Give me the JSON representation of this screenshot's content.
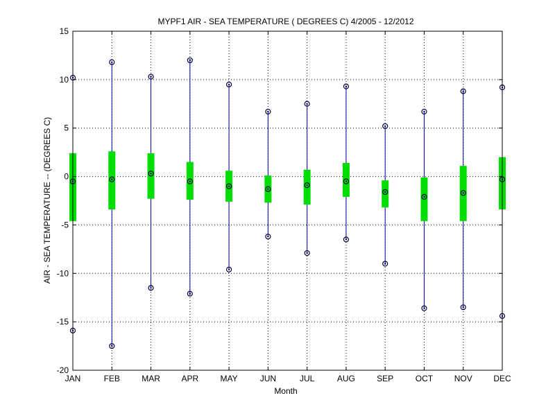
{
  "chart_data": {
    "type": "box",
    "title": "MYPF1  AIR - SEA TEMPERATURE ( DEGREES C) 4/2005 - 12/2012",
    "xlabel": "Month",
    "ylabel": "AIR - SEA TEMPERATURE -- (DEGREES C)",
    "ylim": [
      -20,
      15
    ],
    "yticks": [
      -20,
      -15,
      -10,
      -5,
      0,
      5,
      10,
      15
    ],
    "grid": true,
    "categories": [
      "JAN",
      "FEB",
      "MAR",
      "APR",
      "MAY",
      "JUN",
      "JUL",
      "AUG",
      "SEP",
      "OCT",
      "NOV",
      "DEC"
    ],
    "series": [
      {
        "min": [
          -15.9,
          -17.5,
          -11.5,
          -12.1,
          -9.6,
          -6.2,
          -7.9,
          -6.5,
          -9.0,
          -13.6,
          -13.5,
          -14.4
        ],
        "q1": [
          -4.6,
          -3.4,
          -2.3,
          -2.4,
          -2.6,
          -2.7,
          -2.9,
          -2.1,
          -3.2,
          -4.6,
          -4.6,
          -3.4
        ],
        "median": [
          -0.5,
          -0.3,
          0.3,
          -0.5,
          -1.0,
          -1.3,
          -0.9,
          -0.5,
          -1.6,
          -2.1,
          -1.7,
          -0.3
        ],
        "q3": [
          2.4,
          2.6,
          2.4,
          1.5,
          0.6,
          0.1,
          0.7,
          1.4,
          -0.4,
          -0.1,
          1.1,
          2.0
        ],
        "max": [
          10.2,
          11.8,
          10.3,
          12.0,
          9.5,
          6.7,
          7.5,
          9.3,
          5.2,
          6.7,
          8.8,
          9.2
        ]
      }
    ],
    "colors": {
      "whisker": "#0000aa",
      "box": "#00dd00",
      "marker": "#000044",
      "grid": "#000000",
      "axis": "#000000"
    }
  }
}
